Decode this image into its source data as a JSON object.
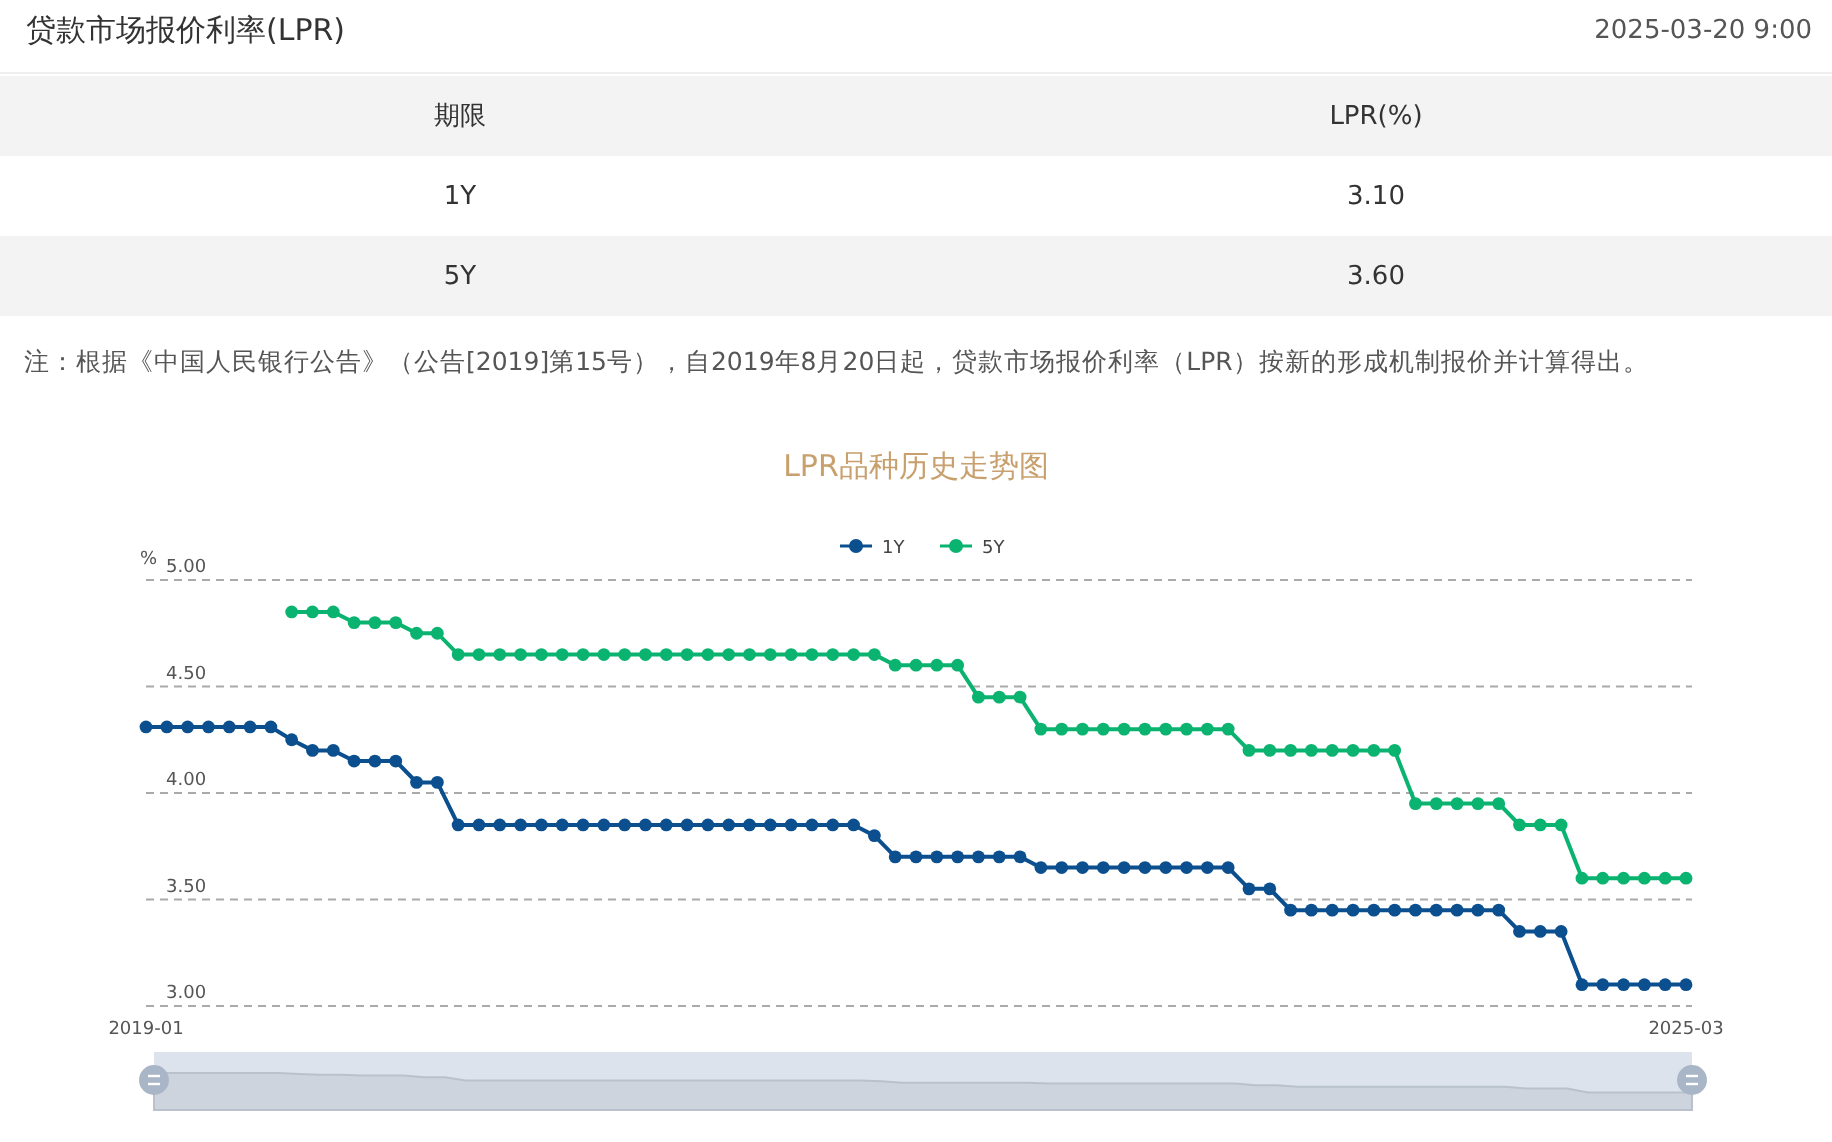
{
  "header": {
    "title": "贷款市场报价利率(LPR)",
    "datetime": "2025-03-20 9:00"
  },
  "table": {
    "columns": [
      "期限",
      "LPR(%)"
    ],
    "rows": [
      [
        "1Y",
        "3.10"
      ],
      [
        "5Y",
        "3.60"
      ]
    ]
  },
  "note": "注：根据《中国人民银行公告》（公告[2019]第15号），自2019年8月20日起，贷款市场报价利率（LPR）按新的形成机制报价并计算得出。",
  "chart": {
    "chart_data": {
      "type": "line",
      "title": "LPR品种历史走势图",
      "ylabel": "%",
      "ylim": [
        3,
        5
      ],
      "yticks": [
        {
          "value": 3,
          "label": "3.00"
        },
        {
          "value": 3.5,
          "label": "3.50"
        },
        {
          "value": 4,
          "label": "4.00"
        },
        {
          "value": 4.5,
          "label": "4.50"
        },
        {
          "value": 5,
          "label": "5.00"
        }
      ],
      "grid": true,
      "legend": "top",
      "categories": [
        "2019-01",
        null,
        null,
        null,
        null,
        null,
        null,
        null,
        null,
        null,
        null,
        null,
        null,
        null,
        null,
        null,
        null,
        null,
        null,
        null,
        null,
        null,
        null,
        null,
        null,
        null,
        null,
        null,
        null,
        null,
        null,
        null,
        null,
        null,
        null,
        null,
        null,
        null,
        null,
        null,
        null,
        null,
        null,
        null,
        null,
        null,
        null,
        null,
        null,
        null,
        null,
        null,
        null,
        null,
        null,
        null,
        null,
        null,
        null,
        null,
        null,
        null,
        null,
        null,
        null,
        null,
        null,
        null,
        null,
        null,
        null,
        null,
        null,
        null,
        "2025-03"
      ],
      "series": [
        {
          "name": "1Y",
          "color": "#0b4f8f",
          "marker": "circle",
          "values": [
            4.31,
            4.31,
            4.31,
            4.31,
            4.31,
            4.31,
            4.31,
            4.25,
            4.2,
            4.2,
            4.15,
            4.15,
            4.15,
            4.05,
            4.05,
            3.85,
            3.85,
            3.85,
            3.85,
            3.85,
            3.85,
            3.85,
            3.85,
            3.85,
            3.85,
            3.85,
            3.85,
            3.85,
            3.85,
            3.85,
            3.85,
            3.85,
            3.85,
            3.85,
            3.85,
            3.8,
            3.7,
            3.7,
            3.7,
            3.7,
            3.7,
            3.7,
            3.7,
            3.65,
            3.65,
            3.65,
            3.65,
            3.65,
            3.65,
            3.65,
            3.65,
            3.65,
            3.65,
            3.55,
            3.55,
            3.45,
            3.45,
            3.45,
            3.45,
            3.45,
            3.45,
            3.45,
            3.45,
            3.45,
            3.45,
            3.45,
            3.35,
            3.35,
            3.35,
            3.1,
            3.1,
            3.1,
            3.1,
            3.1,
            3.1
          ]
        },
        {
          "name": "5Y",
          "color": "#0bb370",
          "marker": "circle",
          "values": [
            null,
            null,
            null,
            null,
            null,
            null,
            null,
            4.85,
            4.85,
            4.85,
            4.8,
            4.8,
            4.8,
            4.75,
            4.75,
            4.65,
            4.65,
            4.65,
            4.65,
            4.65,
            4.65,
            4.65,
            4.65,
            4.65,
            4.65,
            4.65,
            4.65,
            4.65,
            4.65,
            4.65,
            4.65,
            4.65,
            4.65,
            4.65,
            4.65,
            4.65,
            4.6,
            4.6,
            4.6,
            4.6,
            4.45,
            4.45,
            4.45,
            4.3,
            4.3,
            4.3,
            4.3,
            4.3,
            4.3,
            4.3,
            4.3,
            4.3,
            4.3,
            4.2,
            4.2,
            4.2,
            4.2,
            4.2,
            4.2,
            4.2,
            4.2,
            3.95,
            3.95,
            3.95,
            3.95,
            3.95,
            3.85,
            3.85,
            3.85,
            3.6,
            3.6,
            3.6,
            3.6,
            3.6,
            3.6
          ]
        }
      ]
    }
  }
}
